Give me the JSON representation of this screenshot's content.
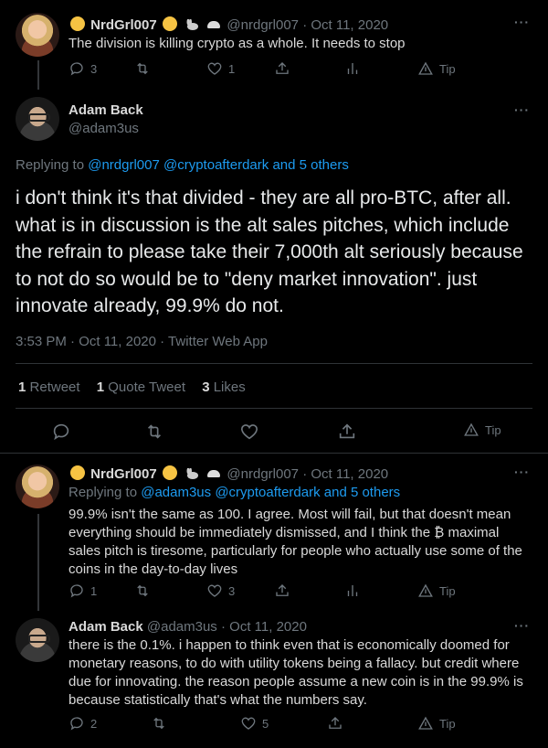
{
  "tweet1": {
    "name": "NrdGrl007",
    "handle": "@nrdgrl007",
    "date": "Oct 11, 2020",
    "text": "The division is killing crypto as a whole. It needs to stop",
    "replies": "3",
    "likes": "1",
    "tip": "Tip"
  },
  "main": {
    "name": "Adam Back",
    "handle": "@adam3us",
    "replying_prefix": "Replying to",
    "replying_users": "@nrdgrl007 @cryptoafterdark",
    "replying_and": "and 5 others",
    "text": "i don't think it's that divided - they are all pro-BTC, after all. what is in discussion is the alt sales pitches, which include the refrain to please take their 7,000th alt seriously because to not do so would be to \"deny market innovation\". just innovate already, 99.9% do not.",
    "timestamp": "3:53 PM · Oct 11, 2020 · Twitter Web App",
    "retweets_count": "1",
    "retweets_label": "Retweet",
    "quotes_count": "1",
    "quotes_label": "Quote Tweet",
    "likes_count": "3",
    "likes_label": "Likes",
    "tip": "Tip"
  },
  "reply1": {
    "name": "NrdGrl007",
    "handle": "@nrdgrl007",
    "date": "Oct 11, 2020",
    "replying_prefix": "Replying to",
    "replying_users": "@adam3us @cryptoafterdark",
    "replying_and": "and 5 others",
    "text": "99.9% isn't the same as 100. I agree. Most will fail, but that doesn't mean everything should be immediately dismissed, and I think the ₿ maximal sales pitch is tiresome, particularly for people who actually use some of the coins in the day-to-day lives",
    "replies": "1",
    "likes": "3",
    "tip": "Tip"
  },
  "reply2": {
    "name": "Adam Back",
    "handle": "@adam3us",
    "date": "Oct 11, 2020",
    "text": "there is the 0.1%. i happen to think even that is economically doomed for monetary reasons, to do with utility tokens being a fallacy. but credit where due for innovating. the reason people assume a new coin is in the 99.9% is because statistically that's what the numbers say.",
    "replies": "2",
    "likes": "5",
    "tip": "Tip"
  },
  "more_label": "···",
  "dot": "·"
}
